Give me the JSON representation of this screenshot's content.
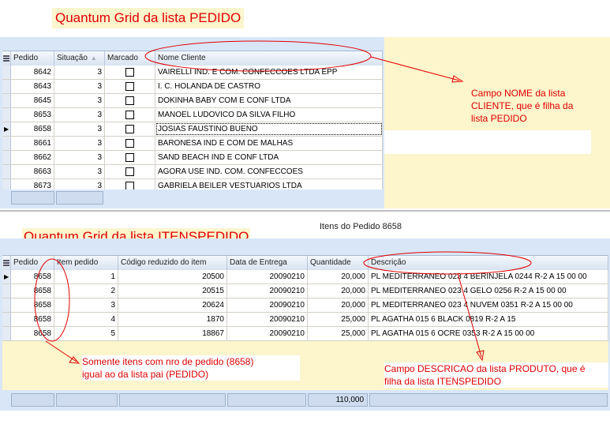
{
  "titles": {
    "top": "Quantum Grid da lista PEDIDO",
    "bottom": "Quantum Grid da lista ITENSPEDIDO",
    "items_caption": "Itens do Pedido 8658"
  },
  "pedido_grid": {
    "columns": [
      "Pedido",
      "Situação",
      "Marcado",
      "Nome Cliente"
    ],
    "rows": [
      {
        "pedido": "8642",
        "situacao": "3",
        "nome": "VAIRELLI IND. E COM. CONFECCOES LTDA EPP"
      },
      {
        "pedido": "8643",
        "situacao": "3",
        "nome": "I. C. HOLANDA DE CASTRO"
      },
      {
        "pedido": "8645",
        "situacao": "3",
        "nome": "DOKINHA BABY COM E CONF LTDA"
      },
      {
        "pedido": "8653",
        "situacao": "3",
        "nome": "MANOEL LUDOVICO DA SILVA FILHO"
      },
      {
        "pedido": "8658",
        "situacao": "3",
        "nome": "JOSIAS FAUSTINO BUENO"
      },
      {
        "pedido": "8661",
        "situacao": "3",
        "nome": "BARONESA IND E COM DE MALHAS"
      },
      {
        "pedido": "8662",
        "situacao": "3",
        "nome": "SAND BEACH IND E CONF LTDA"
      },
      {
        "pedido": "8663",
        "situacao": "3",
        "nome": "AGORA USE IND. COM. CONFECCOES"
      },
      {
        "pedido": "8673",
        "situacao": "3",
        "nome": "GABRIELA BEILER VESTUARIOS LTDA"
      }
    ],
    "selected_index": 4
  },
  "itens_grid": {
    "columns": [
      "Pedido",
      "Item pedido",
      "Código reduzido do item",
      "Data de Entrega",
      "Quantidade",
      "Descrição"
    ],
    "rows": [
      {
        "pedido": "8658",
        "item": "1",
        "codigo": "20500",
        "data": "20090210",
        "qtd": "20,000",
        "desc": "PL MEDITERRANEO 023 4 BERINJELA 0244 R-2 A 15 00 00"
      },
      {
        "pedido": "8658",
        "item": "2",
        "codigo": "20515",
        "data": "20090210",
        "qtd": "20,000",
        "desc": "PL MEDITERRANEO 023 4 GELO 0256 R-2 A 15 00 00"
      },
      {
        "pedido": "8658",
        "item": "3",
        "codigo": "20624",
        "data": "20090210",
        "qtd": "20,000",
        "desc": "PL MEDITERRANEO 023 4 NUVEM 0351 R-2 A 15 00 00"
      },
      {
        "pedido": "8658",
        "item": "4",
        "codigo": "1870",
        "data": "20090210",
        "qtd": "25,000",
        "desc": "PL AGATHA 015 6 BLACK 0819 R-2 A 15"
      },
      {
        "pedido": "8658",
        "item": "5",
        "codigo": "18867",
        "data": "20090210",
        "qtd": "25,000",
        "desc": "PL AGATHA 015 6 OCRE 0353 R-2 A 15 00 00"
      }
    ],
    "footer_total": "110,000"
  },
  "notes": {
    "nome": [
      "Campo NOME da lista",
      "CLIENTE, que é filha da",
      "lista PEDIDO"
    ],
    "somente": [
      "Somente itens com nro de pedido (8658)",
      "igual ao da lista pai (PEDIDO)"
    ],
    "descricao": [
      "Campo DESCRICAO da lista PRODUTO, que é",
      "filha da lista ITENSPEDIDO"
    ]
  },
  "colors": {
    "annotation": "#e00000",
    "grid_frame": "#d8e6f7",
    "note_bg": "#fdf5cc"
  }
}
